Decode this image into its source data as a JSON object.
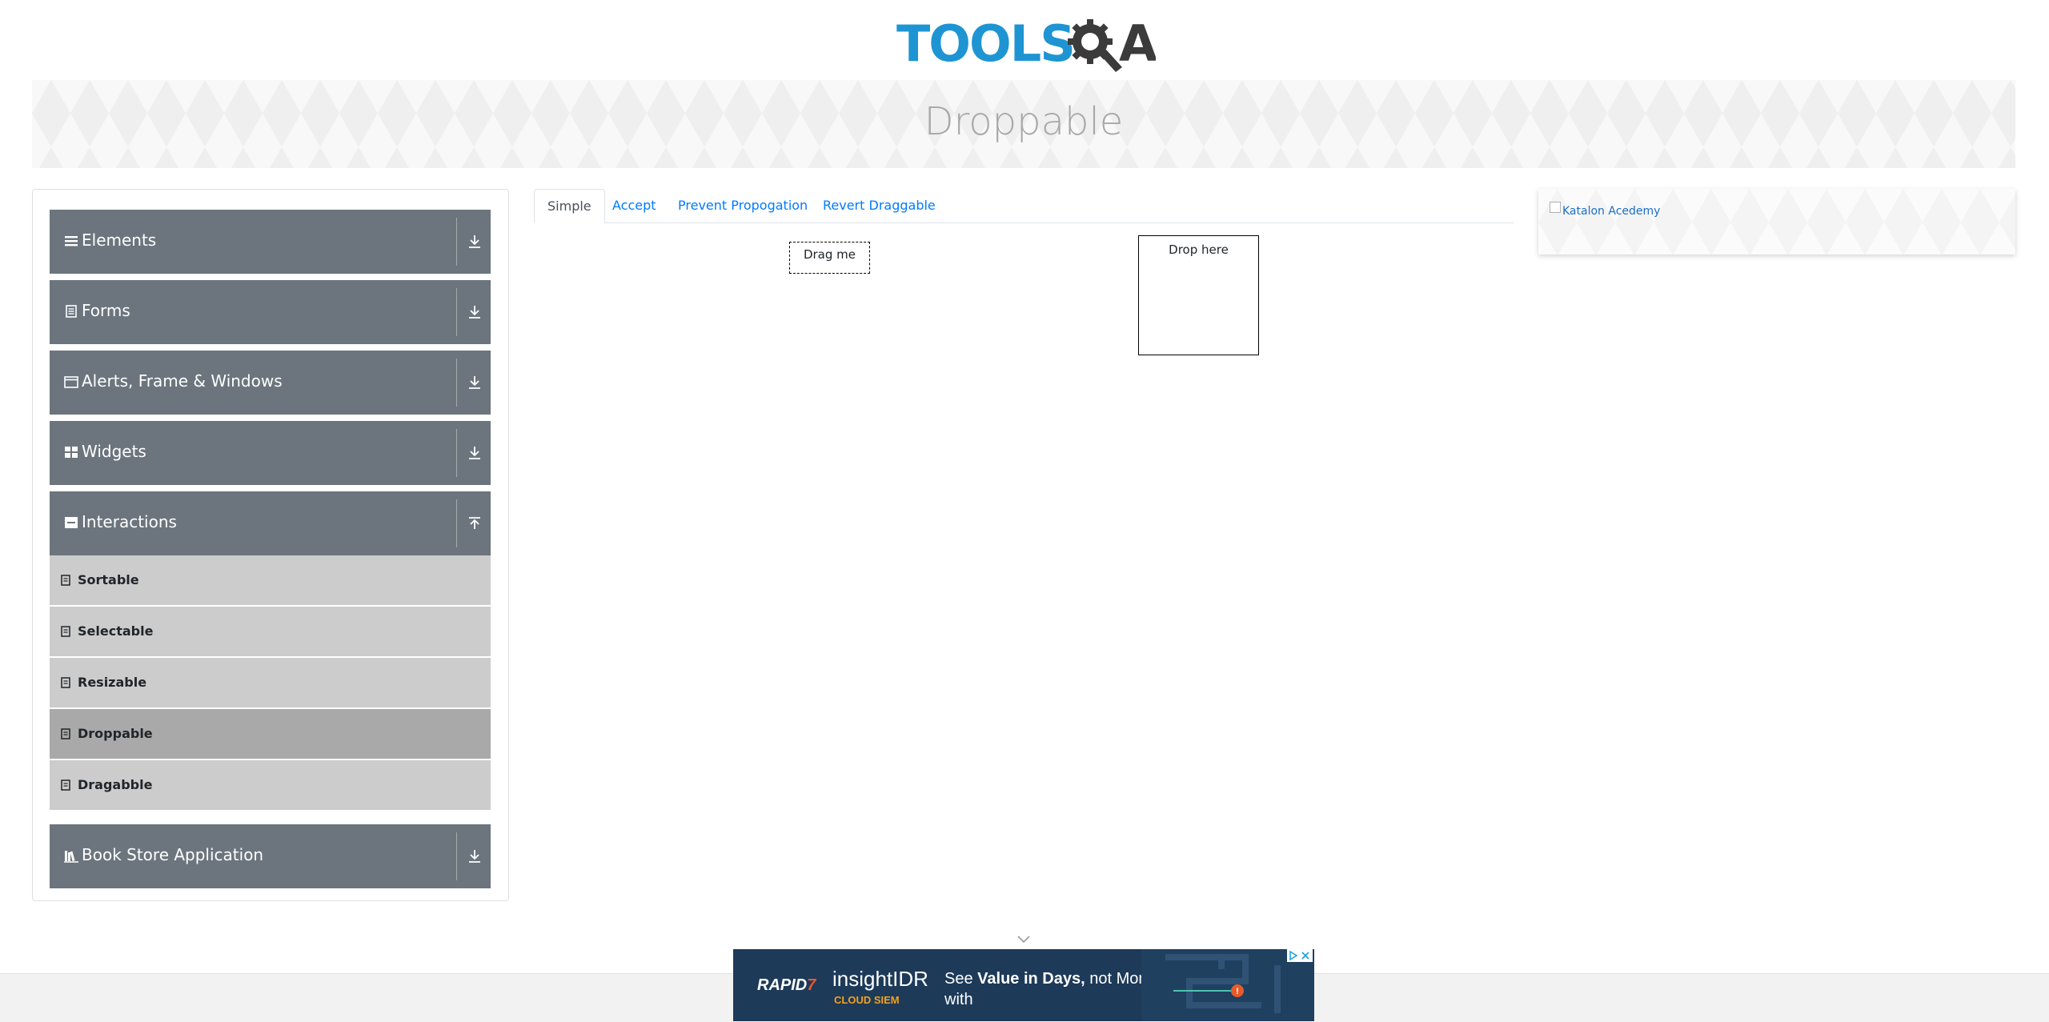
{
  "header": {
    "logo_text_primary": "TOOLS",
    "logo_text_secondary": "A",
    "logo_gear_letter": "Q"
  },
  "banner": {
    "title": "Droppable"
  },
  "sidebar": {
    "groups": [
      {
        "label": "Elements",
        "icon": "list-icon",
        "expanded": false
      },
      {
        "label": "Forms",
        "icon": "form-icon",
        "expanded": false
      },
      {
        "label": "Alerts, Frame & Windows",
        "icon": "window-icon",
        "expanded": false
      },
      {
        "label": "Widgets",
        "icon": "widgets-icon",
        "expanded": false
      },
      {
        "label": "Interactions",
        "icon": "interactions-icon",
        "expanded": true
      },
      {
        "label": "Book Store Application",
        "icon": "books-icon",
        "expanded": false
      }
    ],
    "interactions_items": [
      {
        "label": "Sortable",
        "active": false
      },
      {
        "label": "Selectable",
        "active": false
      },
      {
        "label": "Resizable",
        "active": false
      },
      {
        "label": "Droppable",
        "active": true
      },
      {
        "label": "Dragabble",
        "active": false
      }
    ]
  },
  "tabs": [
    {
      "label": "Simple",
      "active": true
    },
    {
      "label": "Accept",
      "active": false
    },
    {
      "label": "Prevent Propogation",
      "active": false
    },
    {
      "label": "Revert Draggable",
      "active": false
    }
  ],
  "simple": {
    "draggable_label": "Drag me",
    "droppable_label": "Drop here"
  },
  "side_card": {
    "image_alt": "Katalon Acedemy"
  },
  "ad": {
    "brand": "RAPID",
    "brand_accent": "7",
    "product": "insightIDR",
    "subproduct": "CLOUD SIEM",
    "tagline_prefix": "See ",
    "tagline_bold": "Value in Days,",
    "tagline_suffix": " not Months with"
  },
  "colors": {
    "logo_blue": "#1e95d2",
    "logo_dark": "#3b3b3b",
    "sidebar_header": "#6c757d",
    "sidebar_item": "#cccccc",
    "sidebar_item_active": "#a9a9a9",
    "link": "#007bff"
  }
}
